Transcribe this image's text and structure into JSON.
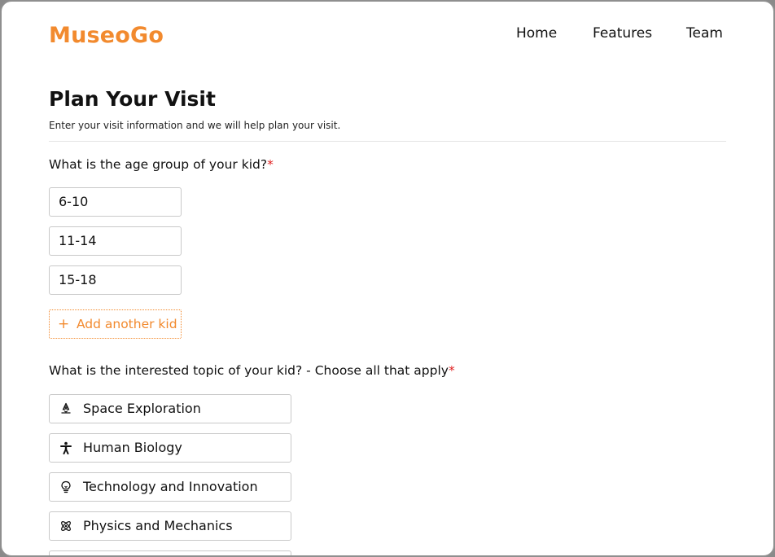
{
  "header": {
    "logo": "MuseoGo",
    "nav": [
      "Home",
      "Features",
      "Team"
    ]
  },
  "page": {
    "title": "Plan Your Visit",
    "subtitle": "Enter your visit information and we will help plan your visit."
  },
  "age_question": {
    "label": "What is the age group of your kid?",
    "required_mark": "*",
    "values": [
      "6-10",
      "11-14",
      "15-18"
    ],
    "add_button": "Add another kid",
    "add_icon": "+"
  },
  "topic_question": {
    "label": "What is the interested topic of your kid? - Choose all that apply",
    "required_mark": "*",
    "options": [
      {
        "label": "Space Exploration",
        "icon": "rocket-icon"
      },
      {
        "label": "Human Biology",
        "icon": "person-icon"
      },
      {
        "label": "Technology and Innovation",
        "icon": "lightbulb-icon"
      },
      {
        "label": "Physics and Mechanics",
        "icon": "atom-icon"
      }
    ]
  },
  "colors": {
    "accent": "#f28a2e",
    "required": "#e02020",
    "border": "#c9c9c9"
  }
}
